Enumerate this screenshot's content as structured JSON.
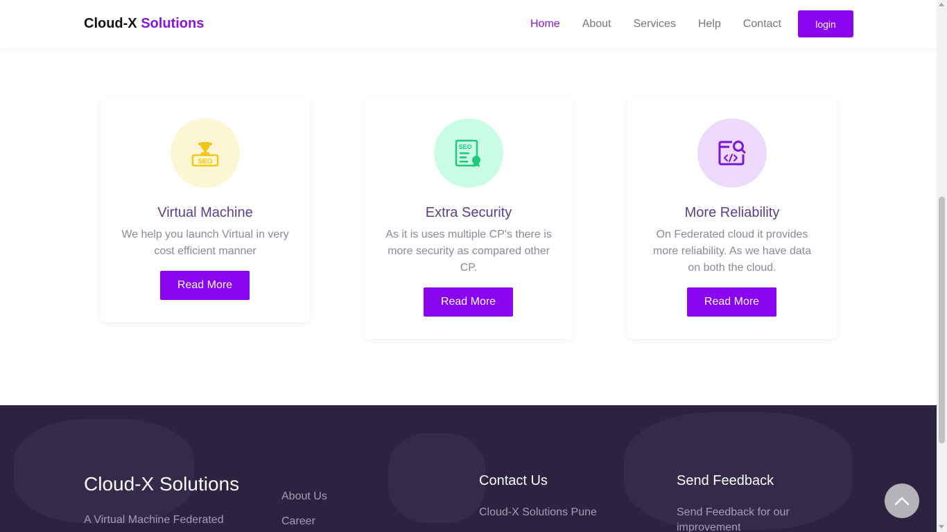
{
  "navbar": {
    "brand_main": "Cloud-X",
    "brand_accent": "Solutions",
    "links": [
      "Home",
      "About",
      "Services",
      "Help",
      "Contact"
    ],
    "active": "Home",
    "login_label": "login"
  },
  "cards": [
    {
      "title": "Virtual Machine",
      "description": "We help you launch Virtual in very cost efficient manner",
      "button": "Read More",
      "icon": "seo-trophy-icon",
      "icon_bg": "#fdf6d2",
      "icon_color": "#f5c518"
    },
    {
      "title": "Extra Security",
      "description": "As it is uses multiple CP's there is more security as compared other CP.",
      "button": "Read More",
      "icon": "seo-certificate-icon",
      "icon_bg": "#c9fbe6",
      "icon_color": "#1fc97a"
    },
    {
      "title": "More Reliability",
      "description": "On Federated cloud it provides more reliability. As we have data on both the cloud.",
      "button": "Read More",
      "icon": "code-search-icon",
      "icon_bg": "#ecd9fb",
      "icon_color": "#7b15d6"
    }
  ],
  "footer": {
    "brand": "Cloud-X Solutions",
    "tagline": "A Virtual Machine Federated",
    "links": [
      "About Us",
      "Career"
    ],
    "contact_heading": "Contact Us",
    "contact_text": "Cloud-X Solutions Pune",
    "feedback_heading": "Send Feedback",
    "feedback_text": "Send Feedback for our improvement"
  },
  "colors": {
    "accent": "#8a04f0",
    "footer_bg": "#2b2340"
  }
}
